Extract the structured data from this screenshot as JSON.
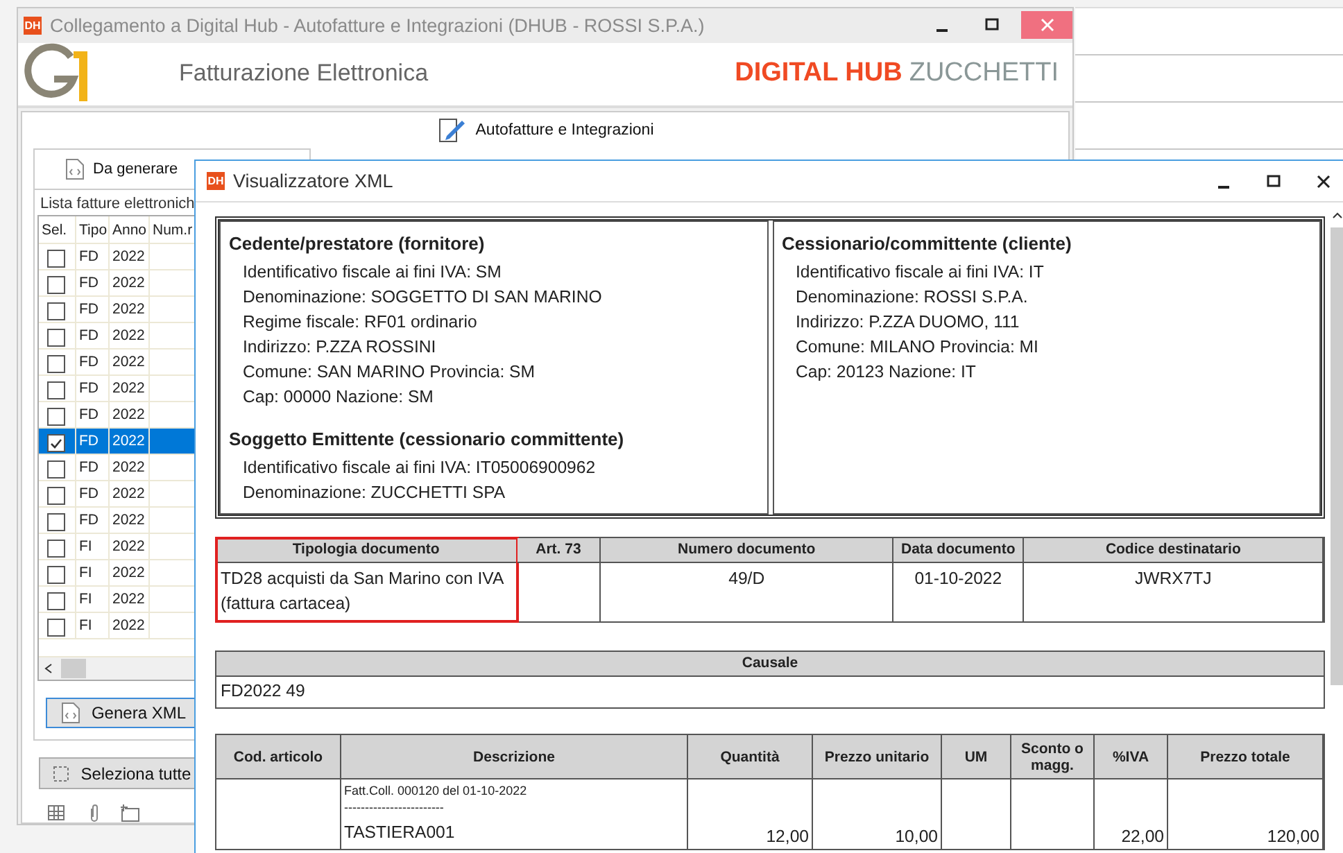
{
  "main_window": {
    "app_badge": "DH",
    "title": "Collegamento a Digital Hub - Autofatture e Integrazioni (DHUB - ROSSI S.P.A.)"
  },
  "header": {
    "title": "Fatturazione Elettronica",
    "brand_bold": "DIGITAL HUB",
    "brand_light": "ZUCCHETTI"
  },
  "toolbar": {
    "button": "Autofatture e Integrazioni"
  },
  "tab": {
    "label": "Da generare"
  },
  "invoice_list": {
    "legend": "Lista fatture elettronich",
    "columns": [
      "Sel.",
      "Tipo",
      "Anno",
      "Num.r"
    ],
    "rows": [
      {
        "checked": false,
        "selected": false,
        "tipo": "FD",
        "anno": "2022"
      },
      {
        "checked": false,
        "selected": false,
        "tipo": "FD",
        "anno": "2022"
      },
      {
        "checked": false,
        "selected": false,
        "tipo": "FD",
        "anno": "2022"
      },
      {
        "checked": false,
        "selected": false,
        "tipo": "FD",
        "anno": "2022"
      },
      {
        "checked": false,
        "selected": false,
        "tipo": "FD",
        "anno": "2022"
      },
      {
        "checked": false,
        "selected": false,
        "tipo": "FD",
        "anno": "2022"
      },
      {
        "checked": false,
        "selected": false,
        "tipo": "FD",
        "anno": "2022"
      },
      {
        "checked": true,
        "selected": true,
        "tipo": "FD",
        "anno": "2022"
      },
      {
        "checked": false,
        "selected": false,
        "tipo": "FD",
        "anno": "2022"
      },
      {
        "checked": false,
        "selected": false,
        "tipo": "FD",
        "anno": "2022"
      },
      {
        "checked": false,
        "selected": false,
        "tipo": "FD",
        "anno": "2022"
      },
      {
        "checked": false,
        "selected": false,
        "tipo": "FI",
        "anno": "2022"
      },
      {
        "checked": false,
        "selected": false,
        "tipo": "FI",
        "anno": "2022"
      },
      {
        "checked": false,
        "selected": false,
        "tipo": "FI",
        "anno": "2022"
      },
      {
        "checked": false,
        "selected": false,
        "tipo": "FI",
        "anno": "2022"
      }
    ]
  },
  "buttons": {
    "generate": "Genera XML",
    "select_all": "Seleziona tutte"
  },
  "viewer": {
    "app_badge": "DH",
    "title": "Visualizzatore XML",
    "supplier": {
      "heading": "Cedente/prestatore (fornitore)",
      "lines": [
        "Identificativo fiscale ai fini IVA: SM",
        "Denominazione: SOGGETTO DI SAN MARINO",
        "Regime fiscale: RF01 ordinario",
        "Indirizzo: P.ZZA ROSSINI",
        "Comune: SAN MARINO Provincia: SM",
        "Cap: 00000 Nazione: SM"
      ]
    },
    "issuer": {
      "heading": "Soggetto Emittente (cessionario committente)",
      "lines": [
        "Identificativo fiscale ai fini IVA: IT05006900962",
        "Denominazione: ZUCCHETTI SPA"
      ]
    },
    "customer": {
      "heading": "Cessionario/committente (cliente)",
      "lines": [
        "Identificativo fiscale ai fini IVA: IT",
        "Denominazione: ROSSI S.P.A.",
        "Indirizzo: P.ZZA DUOMO, 111",
        "Comune: MILANO Provincia: MI",
        "Cap: 20123 Nazione: IT"
      ]
    },
    "document_table": {
      "columns": [
        {
          "label": "Tipologia documento",
          "value": "TD28 acquisti da San Marino con IVA (fattura cartacea)",
          "highlighted": true
        },
        {
          "label": "Art. 73",
          "highlighted": false
        },
        {
          "label": "Numero documento",
          "value": "49/D",
          "highlighted": false
        },
        {
          "label": "Data documento",
          "value": "01-10-2022",
          "highlighted": false
        },
        {
          "label": "Codice destinatario",
          "value": "JWRX7TJ",
          "highlighted": false
        }
      ]
    },
    "causale": {
      "heading": "Causale",
      "value": "FD2022 49"
    },
    "lines_table": {
      "columns": [
        "Cod. articolo",
        "Descrizione",
        "Quantità",
        "Prezzo unitario",
        "UM",
        "Sconto o magg.",
        "%IVA",
        "Prezzo totale"
      ],
      "rows": [
        {
          "description_note": "Fatt.Coll. 000120 del 01-10-2022",
          "description_rule": "------------------------",
          "description": "TASTIERA001",
          "quantity": "12,00",
          "unit_price": "10,00",
          "vat": "22,00",
          "total": "120,00"
        }
      ]
    }
  }
}
